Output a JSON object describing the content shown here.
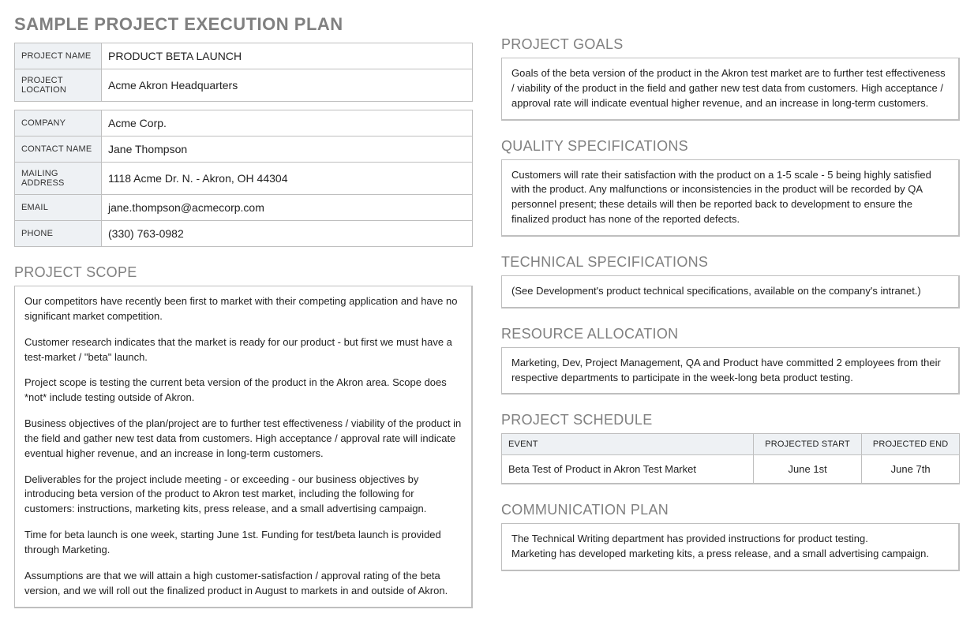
{
  "title": "SAMPLE PROJECT EXECUTION PLAN",
  "project_table": {
    "name_label": "PROJECT NAME",
    "name_value": "PRODUCT BETA LAUNCH",
    "location_label": "PROJECT LOCATION",
    "location_value": "Acme Akron Headquarters"
  },
  "contact_table": {
    "company_label": "COMPANY",
    "company_value": "Acme Corp.",
    "contact_label": "CONTACT NAME",
    "contact_value": "Jane Thompson",
    "mailing_label": "MAILING ADDRESS",
    "mailing_value": "1118 Acme Dr. N. - Akron, OH 44304",
    "email_label": "EMAIL",
    "email_value": "jane.thompson@acmecorp.com",
    "phone_label": "PHONE",
    "phone_value": "(330) 763-0982"
  },
  "sections": {
    "scope_title": "PROJECT SCOPE",
    "scope_paragraphs": {
      "p1": "Our competitors have recently been first to market with their competing application and have no significant market competition.",
      "p2": "Customer research indicates that the market is ready for our product - but first we must have a test-market / \"beta\" launch.",
      "p3": "Project scope is testing the current beta version of the product in the Akron area. Scope does *not* include testing outside of Akron.",
      "p4": "Business objectives of the plan/project are to further test effectiveness / viability of the product in the field and gather new test data from customers. High acceptance / approval rate will indicate eventual higher revenue, and an increase in long-term customers.",
      "p5": "Deliverables for the project include meeting - or exceeding - our business objectives by introducing beta version of the product to Akron test market, including the following for customers: instructions, marketing kits, press release, and a small advertising campaign.",
      "p6": "Time for beta launch is one week, starting June 1st. Funding for test/beta launch is provided through Marketing.",
      "p7": "Assumptions are that we will attain a high customer-satisfaction / approval rating of the beta version, and we will roll out the finalized product in August to markets in and outside of Akron."
    },
    "goals_title": "PROJECT GOALS",
    "goals_text": "Goals of the beta version of the product in the Akron test market are to further test effectiveness / viability of the product in the field and gather new test data from customers. High acceptance / approval rate will indicate eventual higher revenue, and an increase in long-term customers.",
    "quality_title": "QUALITY SPECIFICATIONS",
    "quality_text": "Customers will rate their satisfaction with the product on a 1-5 scale - 5 being highly satisfied with the product. Any malfunctions or inconsistencies in the product will be recorded by QA personnel present; these details will then be reported back to development to ensure the finalized product has none of the reported defects.",
    "technical_title": "TECHNICAL SPECIFICATIONS",
    "technical_text": "(See Development's product technical specifications, available on the company's intranet.)",
    "resource_title": "RESOURCE ALLOCATION",
    "resource_text": "Marketing, Dev, Project Management, QA and Product have committed 2 employees from their respective departments to participate in the week-long beta product testing.",
    "schedule_title": "PROJECT SCHEDULE",
    "schedule_headers": {
      "event": "EVENT",
      "start": "PROJECTED START",
      "end": "PROJECTED END"
    },
    "schedule_row": {
      "event": "Beta Test of Product in Akron Test Market",
      "start": "June 1st",
      "end": "June 7th"
    },
    "comm_title": "COMMUNICATION PLAN",
    "comm_line1": "The Technical Writing department has provided instructions for product testing.",
    "comm_line2": "Marketing has developed marketing kits, a press release, and a small advertising campaign."
  }
}
